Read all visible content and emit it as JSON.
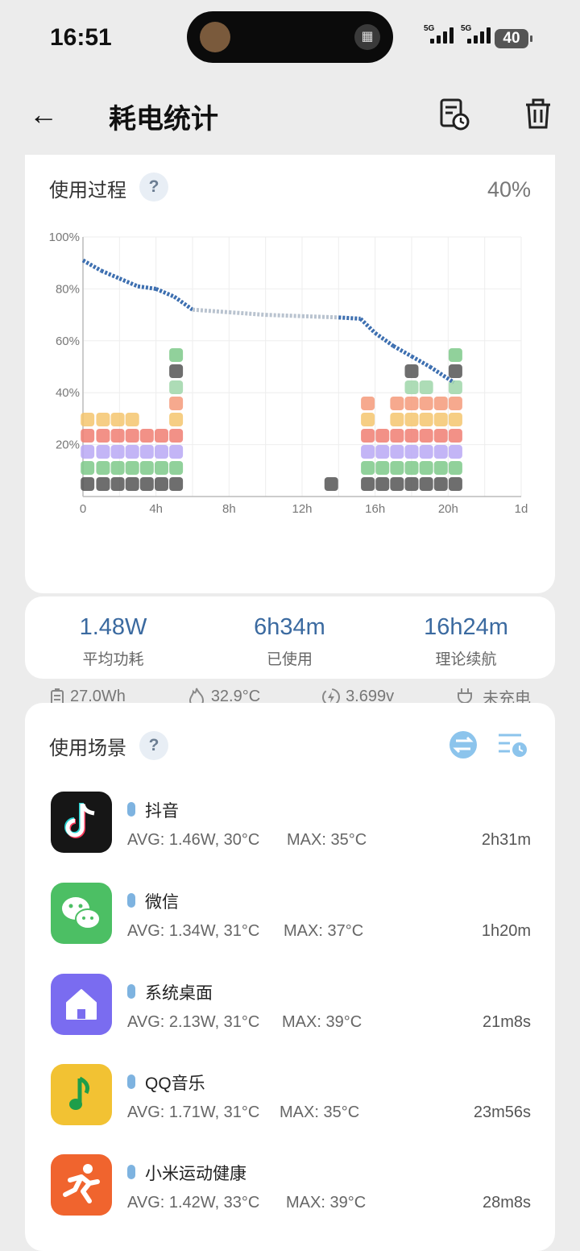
{
  "status_bar": {
    "time": "16:51",
    "battery": "40",
    "network": [
      "5G",
      "5G"
    ]
  },
  "header": {
    "title": "耗电统计"
  },
  "process": {
    "title": "使用过程",
    "help": "?",
    "current_level": "40%",
    "footer": {
      "capacity": "27.0Wh",
      "temperature": "32.9°C",
      "voltage": "3.699v",
      "charging": "未充电"
    }
  },
  "chart_data": {
    "type": "line",
    "title": "",
    "x_ticks": [
      "0",
      "4h",
      "8h",
      "12h",
      "16h",
      "20h",
      "1d"
    ],
    "y_ticks": [
      "100%",
      "80%",
      "60%",
      "40%",
      "20%"
    ],
    "ylim": [
      0,
      100
    ],
    "xlim": [
      0,
      24
    ],
    "grid": true,
    "series": [
      {
        "x": [
          0,
          1,
          2,
          3,
          4,
          5,
          6,
          8,
          10,
          12,
          14,
          15.2,
          16,
          17,
          18,
          19,
          20.3
        ],
        "y": [
          91,
          87,
          84,
          81,
          80,
          77,
          72,
          71,
          70,
          69.5,
          69,
          68.5,
          63,
          58,
          54,
          50,
          44
        ]
      }
    ]
  },
  "summary": {
    "avg_power": {
      "value": "1.48W",
      "label": "平均功耗"
    },
    "used": {
      "value": "6h34m",
      "label": "已使用"
    },
    "remaining": {
      "value": "16h24m",
      "label": "理论续航"
    }
  },
  "scenes": {
    "title": "使用场景",
    "help": "?",
    "apps": [
      {
        "name": "抖音",
        "avg": "AVG: 1.46W, 30°C",
        "max": "MAX:  35°C",
        "duration": "2h31m",
        "icon": "douyin-icon",
        "color": "#1a1a1a"
      },
      {
        "name": "微信",
        "avg": "AVG: 1.34W, 31°C",
        "max": "MAX:  37°C",
        "duration": "1h20m",
        "icon": "wechat-icon",
        "color": "#4cbf64"
      },
      {
        "name": "系统桌面",
        "avg": "AVG: 2.13W, 31°C",
        "max": "MAX:  39°C",
        "duration": "21m8s",
        "icon": "home-icon",
        "color": "#7a6cf0"
      },
      {
        "name": "QQ音乐",
        "avg": "AVG: 1.71W, 31°C",
        "max": "MAX:  35°C",
        "duration": "23m56s",
        "icon": "music-icon",
        "color": "#f2c233"
      },
      {
        "name": "小米运动健康",
        "avg": "AVG: 1.42W, 33°C",
        "max": "MAX:  39°C",
        "duration": "28m8s",
        "icon": "runner-icon",
        "color": "#f0642e"
      }
    ]
  }
}
